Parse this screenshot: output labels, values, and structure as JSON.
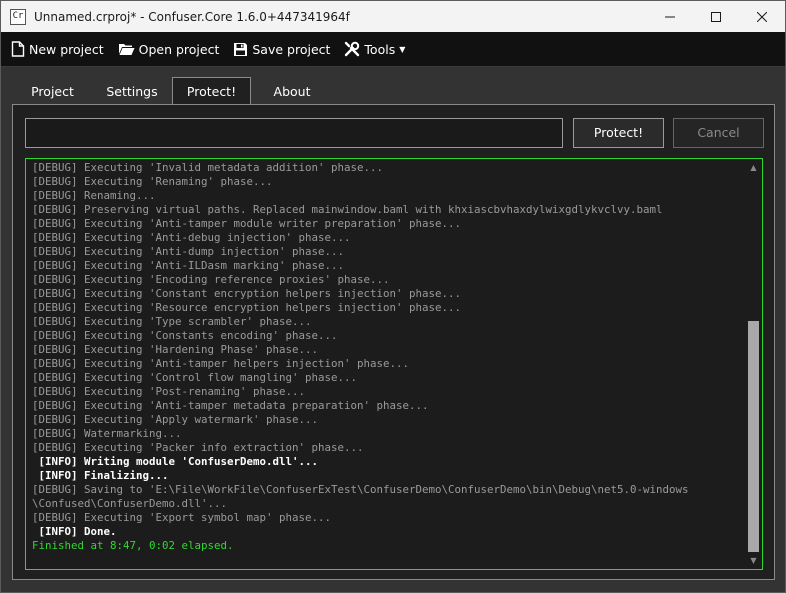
{
  "window": {
    "title": "Unnamed.crproj* - Confuser.Core 1.6.0+447341964f",
    "icon_text": "Cr"
  },
  "toolbar": {
    "new_project": "New project",
    "open_project": "Open project",
    "save_project": "Save project",
    "tools": "Tools"
  },
  "tabs": [
    {
      "label": "Project",
      "active": false
    },
    {
      "label": "Settings",
      "active": false
    },
    {
      "label": "Protect!",
      "active": true
    },
    {
      "label": "About",
      "active": false
    }
  ],
  "protect_tab": {
    "path_value": "",
    "protect_label": "Protect!",
    "cancel_label": "Cancel"
  },
  "log": {
    "lines": [
      {
        "level": "debug",
        "text": "[DEBUG] Executing 'Invalid metadata addition' phase..."
      },
      {
        "level": "debug",
        "text": "[DEBUG] Executing 'Renaming' phase..."
      },
      {
        "level": "debug",
        "text": "[DEBUG] Renaming..."
      },
      {
        "level": "debug",
        "text": "[DEBUG] Preserving virtual paths. Replaced mainwindow.baml with khxiascbvhaxdylwixgdlykvclvy.baml"
      },
      {
        "level": "debug",
        "text": "[DEBUG] Executing 'Anti-tamper module writer preparation' phase..."
      },
      {
        "level": "debug",
        "text": "[DEBUG] Executing 'Anti-debug injection' phase..."
      },
      {
        "level": "debug",
        "text": "[DEBUG] Executing 'Anti-dump injection' phase..."
      },
      {
        "level": "debug",
        "text": "[DEBUG] Executing 'Anti-ILDasm marking' phase..."
      },
      {
        "level": "debug",
        "text": "[DEBUG] Executing 'Encoding reference proxies' phase..."
      },
      {
        "level": "debug",
        "text": "[DEBUG] Executing 'Constant encryption helpers injection' phase..."
      },
      {
        "level": "debug",
        "text": "[DEBUG] Executing 'Resource encryption helpers injection' phase..."
      },
      {
        "level": "debug",
        "text": "[DEBUG] Executing 'Type scrambler' phase..."
      },
      {
        "level": "debug",
        "text": "[DEBUG] Executing 'Constants encoding' phase..."
      },
      {
        "level": "debug",
        "text": "[DEBUG] Executing 'Hardening Phase' phase..."
      },
      {
        "level": "debug",
        "text": "[DEBUG] Executing 'Anti-tamper helpers injection' phase..."
      },
      {
        "level": "debug",
        "text": "[DEBUG] Executing 'Control flow mangling' phase..."
      },
      {
        "level": "debug",
        "text": "[DEBUG] Executing 'Post-renaming' phase..."
      },
      {
        "level": "debug",
        "text": "[DEBUG] Executing 'Anti-tamper metadata preparation' phase..."
      },
      {
        "level": "debug",
        "text": "[DEBUG] Executing 'Apply watermark' phase..."
      },
      {
        "level": "debug",
        "text": "[DEBUG] Watermarking..."
      },
      {
        "level": "debug",
        "text": "[DEBUG] Executing 'Packer info extraction' phase..."
      },
      {
        "level": "info",
        "text": " [INFO] Writing module 'ConfuserDemo.dll'..."
      },
      {
        "level": "info",
        "text": " [INFO] Finalizing..."
      },
      {
        "level": "debug",
        "text": "[DEBUG] Saving to 'E:\\File\\WorkFile\\ConfuserExTest\\ConfuserDemo\\ConfuserDemo\\bin\\Debug\\net5.0-windows"
      },
      {
        "level": "debug",
        "text": "\\Confused\\ConfuserDemo.dll'..."
      },
      {
        "level": "debug",
        "text": "[DEBUG] Executing 'Export symbol map' phase..."
      },
      {
        "level": "info",
        "text": " [INFO] Done."
      },
      {
        "level": "done",
        "text": "Finished at 8:47, 0:02 elapsed."
      }
    ]
  },
  "icons": {
    "new": "new-file-icon",
    "open": "folder-open-icon",
    "save": "floppy-disk-icon",
    "tools": "tools-icon"
  },
  "colors": {
    "log_border": "#2fd82f",
    "finished_text": "#2fd82f",
    "debug_text": "#9a9a9a",
    "info_text": "#ffffff"
  }
}
